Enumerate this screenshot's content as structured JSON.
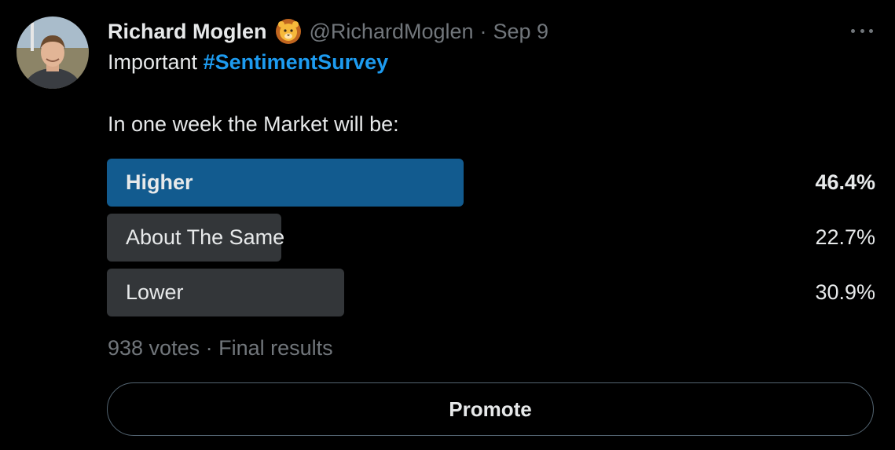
{
  "author": {
    "display_name": "Richard Moglen",
    "badge_icon": "lion-face-icon",
    "handle": "@RichardMoglen",
    "separator": "·",
    "date": "Sep 9"
  },
  "tweet": {
    "text_prefix": "Important",
    "hashtag": "#SentimentSurvey"
  },
  "poll": {
    "question": "In one week the Market will be:",
    "options": [
      {
        "label": "Higher",
        "percent_text": "46.4%",
        "percent": 46.4,
        "winner": true
      },
      {
        "label": "About The Same",
        "percent_text": "22.7%",
        "percent": 22.7,
        "winner": false
      },
      {
        "label": "Lower",
        "percent_text": "30.9%",
        "percent": 30.9,
        "winner": false
      }
    ],
    "votes": "938 votes",
    "meta_separator": "·",
    "status": "Final results"
  },
  "actions": {
    "promote_label": "Promote",
    "more_icon": "more-horizontal-icon"
  },
  "colors": {
    "background": "#000000",
    "hashtag": "#1d9bf0",
    "winner_bar": "#125b8f",
    "option_bar": "#333639",
    "muted_text": "#71767b"
  }
}
